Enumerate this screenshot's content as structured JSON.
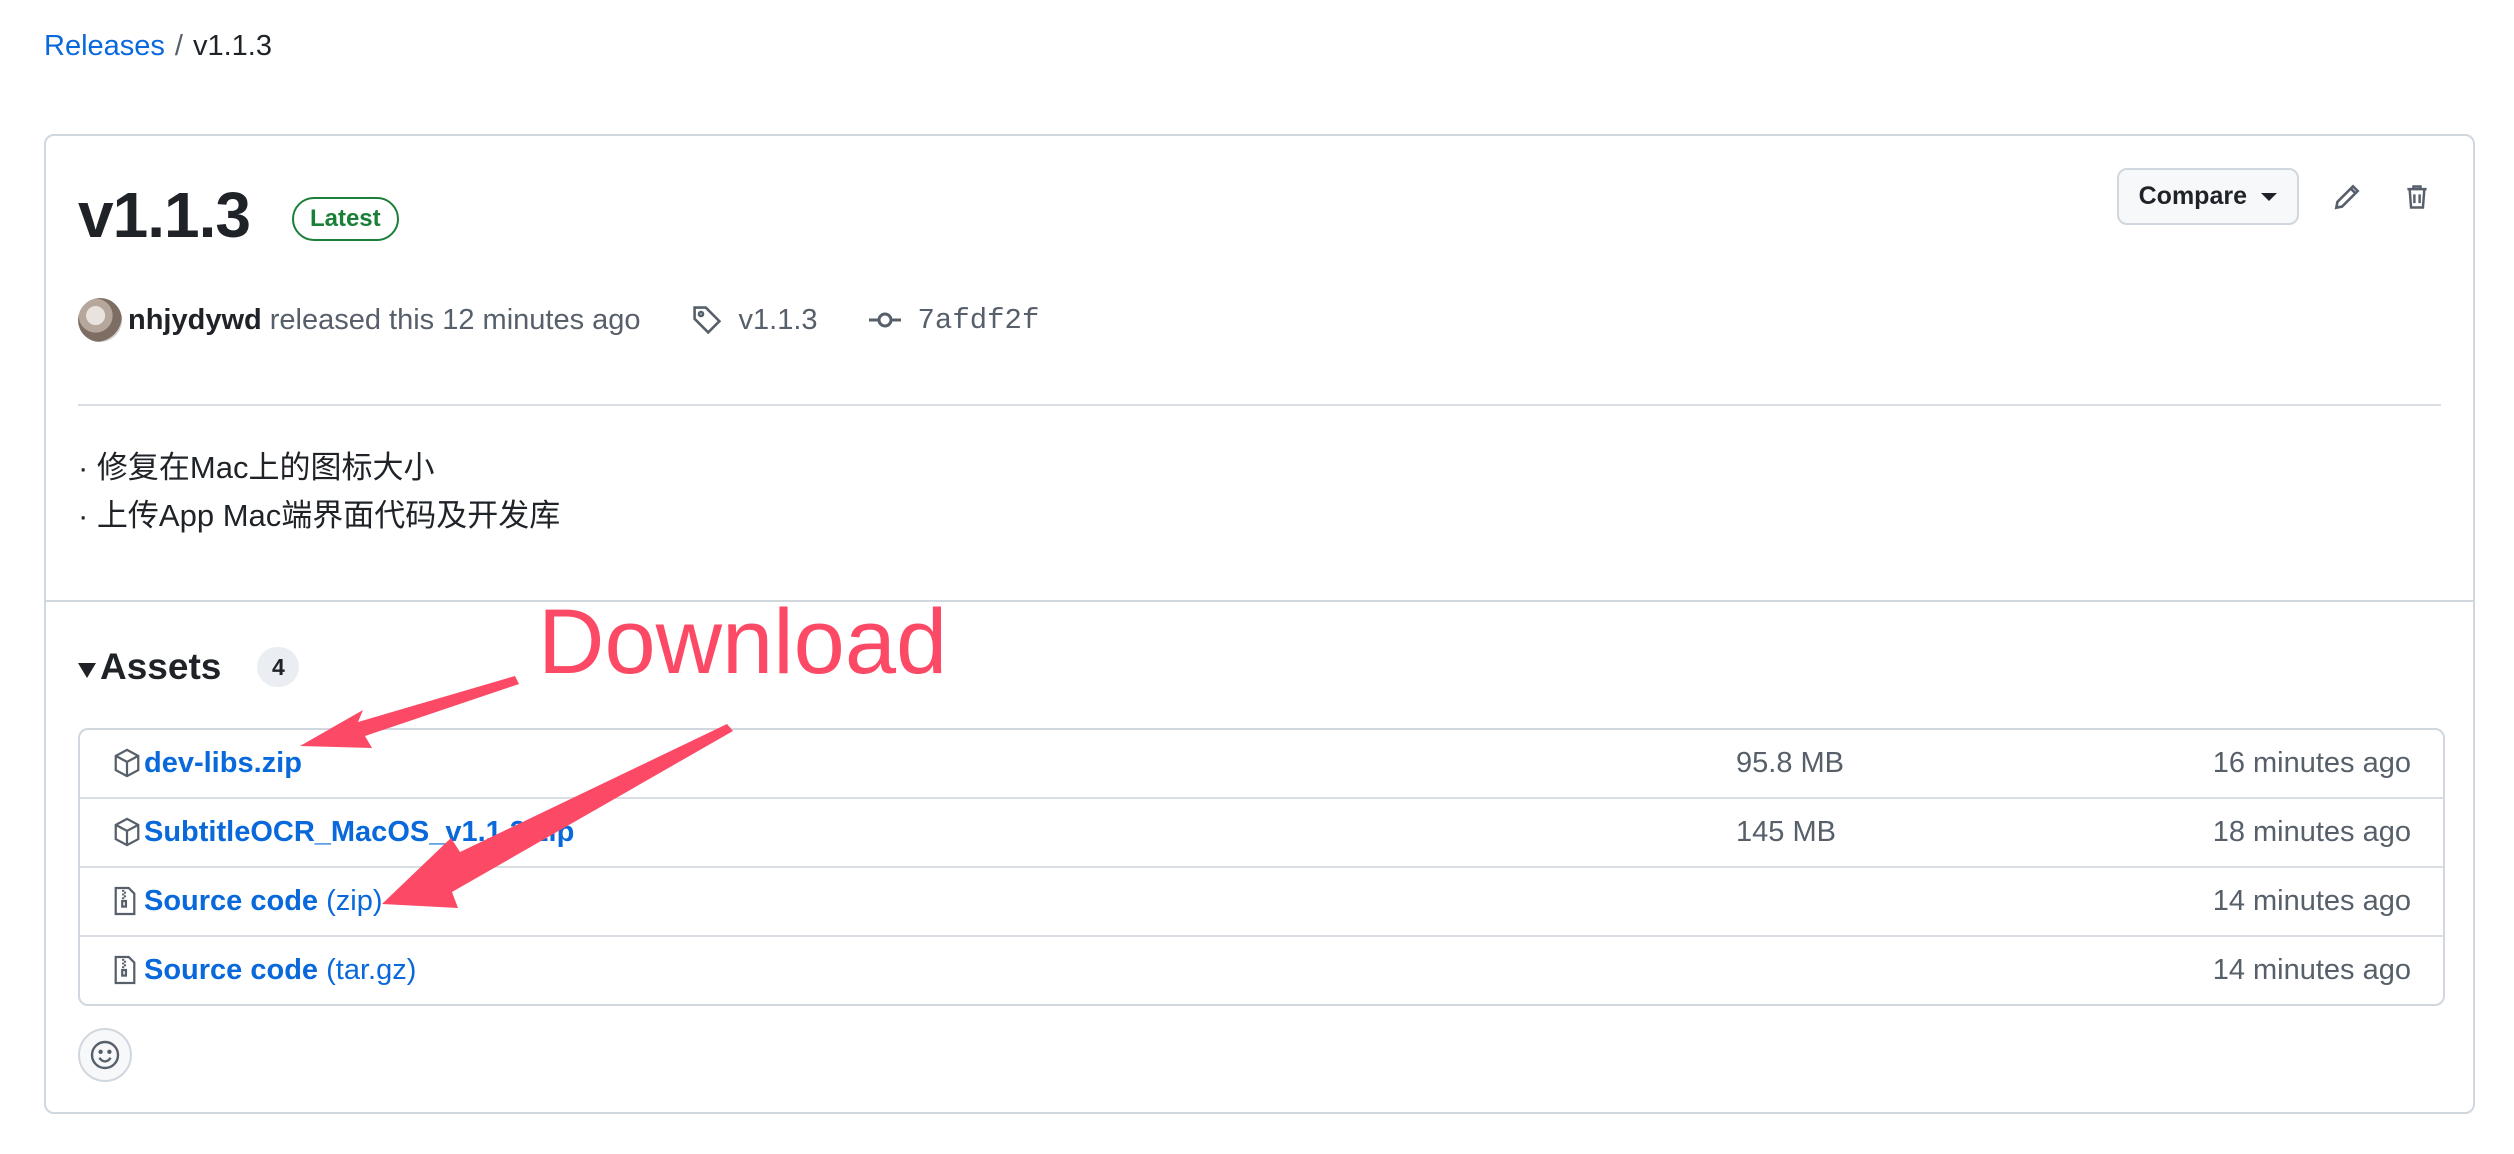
{
  "breadcrumb": {
    "root": "Releases",
    "separator": "/",
    "current": "v1.1.3"
  },
  "release": {
    "title": "v1.1.3",
    "badge": "Latest",
    "author": "nhjydywd",
    "released_text": "released this 12 minutes ago",
    "tag": "v1.1.3",
    "commit": "7afdf2f",
    "notes": [
      "· 修复在Mac上的图标大小",
      "· 上传App Mac端界面代码及开发库"
    ]
  },
  "actions": {
    "compare_label": "Compare",
    "edit_icon": "pencil-icon",
    "delete_icon": "trash-icon"
  },
  "assets": {
    "title": "Assets",
    "count": "4",
    "items": [
      {
        "name": "dev-libs.zip",
        "format": "",
        "size": "95.8 MB",
        "time": "16 minutes ago",
        "icon": "package-icon"
      },
      {
        "name": "SubtitleOCR_MacOS_v1.1.3.zip",
        "format": "",
        "size": "145 MB",
        "time": "18 minutes ago",
        "icon": "package-icon"
      },
      {
        "name": "Source code",
        "format": "(zip)",
        "size": "",
        "time": "14 minutes ago",
        "icon": "file-zip-icon"
      },
      {
        "name": "Source code",
        "format": "(tar.gz)",
        "size": "",
        "time": "14 minutes ago",
        "icon": "file-zip-icon"
      }
    ]
  },
  "annotation": {
    "text": "Download",
    "color": "#fc4966"
  },
  "colors": {
    "link": "#0969da",
    "latest": "#1a7f37",
    "border": "#d0d7de",
    "muted": "#57606a"
  }
}
